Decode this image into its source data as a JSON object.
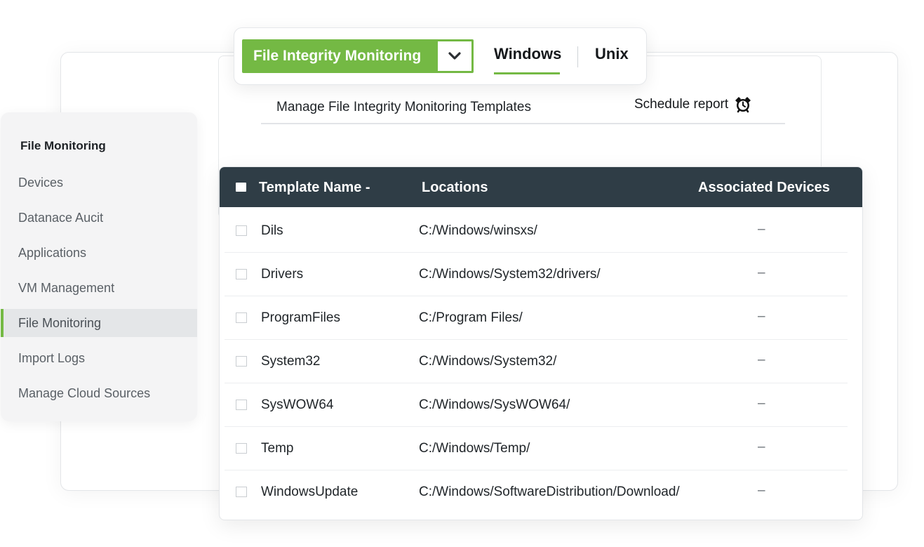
{
  "tabbar": {
    "module_label": "File Integrity  Monitoring",
    "tabs": [
      "Windows",
      "Unix"
    ],
    "active_tab": "Windows"
  },
  "header": {
    "title": "Manage File Integrity Monitoring Templates",
    "schedule_label": "Schedule report"
  },
  "sidebar": {
    "title": "File Monitoring",
    "items": [
      "Devices",
      "Datanace Aucit",
      "Applications",
      "VM Management",
      "File Monitoring",
      "Import Logs",
      "Manage Cloud Sources"
    ],
    "active_item": "File Monitoring"
  },
  "table": {
    "columns": [
      "Template Name -",
      "Locations",
      "Associated Devices"
    ],
    "rows": [
      {
        "name": "Dils",
        "location": "C:/Windows/winsxs/",
        "devices": "–"
      },
      {
        "name": "Drivers",
        "location": "C:/Windows/System32/drivers/",
        "devices": "–"
      },
      {
        "name": "ProgramFiles",
        "location": "C:/Program Files/",
        "devices": "–"
      },
      {
        "name": "System32",
        "location": "C:/Windows/System32/",
        "devices": "–"
      },
      {
        "name": "SysWOW64",
        "location": "C:/Windows/SysWOW64/",
        "devices": "–"
      },
      {
        "name": "Temp",
        "location": "C:/Windows/Temp/",
        "devices": "–"
      },
      {
        "name": "WindowsUpdate",
        "location": "C:/Windows/SoftwareDistribution/Download/",
        "devices": "–"
      }
    ]
  },
  "colors": {
    "accent": "#74b944",
    "table_header": "#2f3d46",
    "sidebar_bg": "#f4f4f5"
  },
  "icons": {
    "module_dropdown": "chevron-down-icon",
    "schedule": "alarm-clock-icon"
  }
}
